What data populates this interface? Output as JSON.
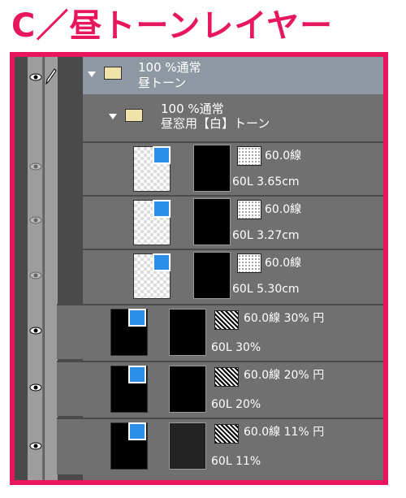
{
  "title": "C／昼トーンレイヤー",
  "folders": [
    {
      "line1": "100 %通常",
      "line2": "昼トーン"
    },
    {
      "line1": "100 %通常",
      "line2": "昼窓用【白】トーン"
    }
  ],
  "layers": [
    {
      "tone": "60.0線",
      "info": "60L 3.65cm",
      "style": "white"
    },
    {
      "tone": "60.0線",
      "info": "60L 3.27cm",
      "style": "white"
    },
    {
      "tone": "60.0線",
      "info": "60L 5.30cm",
      "style": "white"
    },
    {
      "tone": "60.0線 30% 円",
      "info": "60L 30%",
      "style": "black"
    },
    {
      "tone": "60.0線 20% 円",
      "info": "60L 20%",
      "style": "black"
    },
    {
      "tone": "60.0線 11% 円",
      "info": "60L 11%",
      "style": "black"
    }
  ],
  "colors": {
    "accent": "#e8175d",
    "badge": "#2a8fe8"
  }
}
